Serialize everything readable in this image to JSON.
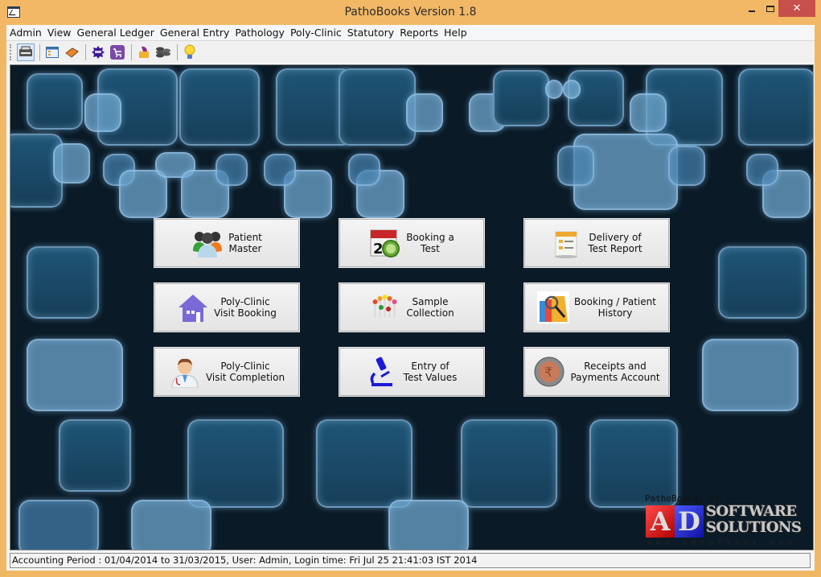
{
  "window": {
    "title": "PathoBooks Version 1.8",
    "minimize_label": "–",
    "close_label": "✕"
  },
  "menubar": {
    "items": [
      "Admin",
      "View",
      "General Ledger",
      "General Entry",
      "Pathology",
      "Poly-Clinic",
      "Statutory",
      "Reports",
      "Help"
    ]
  },
  "toolbar": {
    "buttons": [
      "printer-icon",
      "layout-icon",
      "ledger-book-icon",
      "badge-icon",
      "cart-icon",
      "wallet-icon",
      "coins-stack-icon",
      "lightbulb-icon"
    ]
  },
  "dashboard": {
    "buttons": [
      {
        "line1": "Patient",
        "line2": "Master",
        "icon": "patients-icon"
      },
      {
        "line1": "Booking a",
        "line2": "Test",
        "icon": "calendar-clock-icon"
      },
      {
        "line1": "Delivery of",
        "line2": "Test Report",
        "icon": "report-document-icon"
      },
      {
        "line1": "Poly-Clinic",
        "line2": "Visit Booking",
        "icon": "house-icon"
      },
      {
        "line1": "Sample",
        "line2": "Collection",
        "icon": "test-tubes-icon"
      },
      {
        "line1": "Booking / Patient",
        "line2": "History",
        "icon": "folders-magnifier-icon"
      },
      {
        "line1": "Poly-Clinic",
        "line2": "Visit Completion",
        "icon": "doctor-icon"
      },
      {
        "line1": "Entry of",
        "line2": "Test Values",
        "icon": "microscope-icon"
      },
      {
        "line1": "Receipts and",
        "line2": "Payments Account",
        "icon": "rupee-coin-icon"
      }
    ]
  },
  "branding": {
    "credit": "PathoBooks, By :-",
    "logo_letters": [
      "A",
      "D"
    ],
    "logo_line1": "SOFTWARE",
    "logo_line2": "SOLUTIONS",
    "logo_url": "www.adsoftsol.com"
  },
  "statusbar": {
    "text": "Accounting Period : 01/04/2014 to 31/03/2015, User: Admin, Login time: Fri Jul 25 21:41:03 IST 2014"
  }
}
